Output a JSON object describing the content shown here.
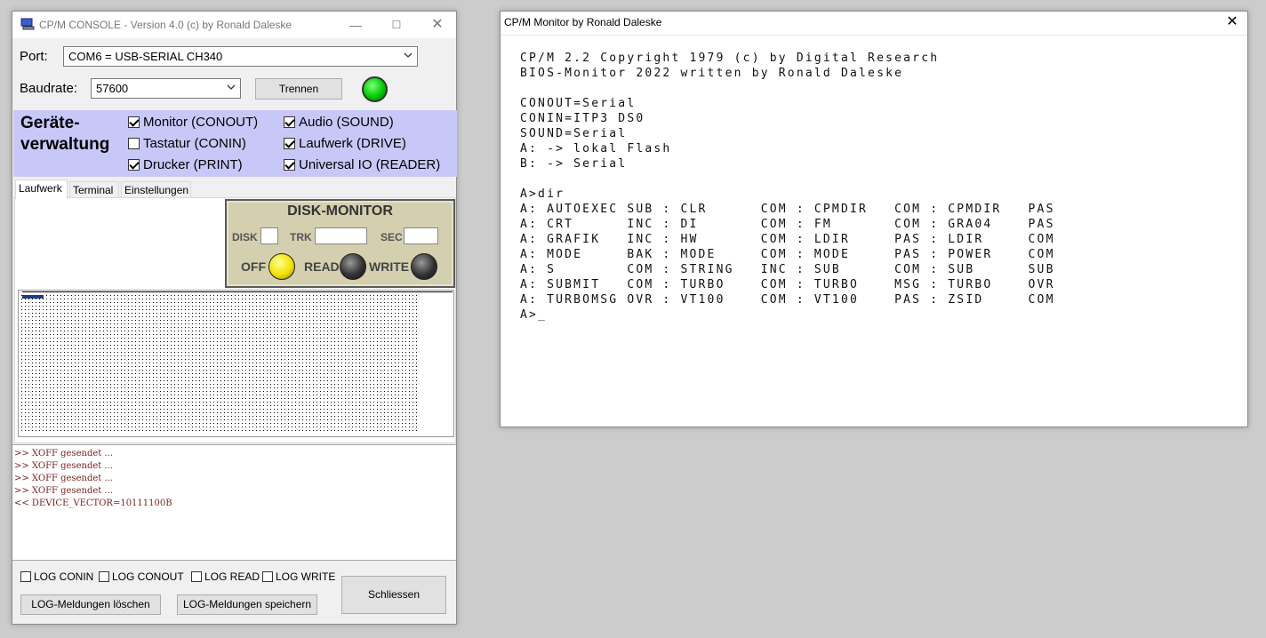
{
  "console": {
    "title": "CP/M CONSOLE - Version 4.0 (c) by Ronald Daleske",
    "port_label": "Port:",
    "port_value": "COM6 = USB-SERIAL CH340",
    "baudrate_label": "Baudrate:",
    "baudrate_value": "57600",
    "disconnect_button": "Trennen",
    "status_led_color": "#00cc00",
    "devices": {
      "title_line1": "Geräte-",
      "title_line2": "verwaltung",
      "items": [
        {
          "label": "Monitor (CONOUT)",
          "checked": true
        },
        {
          "label": "Tastatur (CONIN)",
          "checked": false
        },
        {
          "label": "Drucker (PRINT)",
          "checked": true
        },
        {
          "label": "Audio (SOUND)",
          "checked": true
        },
        {
          "label": "Laufwerk (DRIVE)",
          "checked": true
        },
        {
          "label": "Universal IO (READER)",
          "checked": true
        }
      ]
    },
    "tabs": [
      "Laufwerk",
      "Terminal",
      "Einstellungen"
    ],
    "disk_monitor": {
      "title": "DISK-MONITOR",
      "disk_label": "DISK",
      "trk_label": "TRK",
      "sec_label": "SEC",
      "off_label": "OFF",
      "read_label": "READ",
      "write_label": "WRITE",
      "off_color": "#f2e200",
      "read_color": "#333333",
      "write_color": "#333333"
    },
    "log_lines": [
      ">> XOFF gesendet ...",
      ">> XOFF gesendet ...",
      ">> XOFF gesendet ...",
      ">> XOFF gesendet ...",
      "<< DEVICE_VECTOR=10111100B"
    ],
    "log_options": [
      "LOG CONIN",
      "LOG CONOUT",
      "LOG READ",
      "LOG WRITE"
    ],
    "clear_log_button": "LOG-Meldungen löschen",
    "save_log_button": "LOG-Meldungen speichern",
    "close_button": "Schliessen"
  },
  "monitor": {
    "title": "CP/M Monitor by Ronald Daleske",
    "lines": [
      "CP/M 2.2 Copyright 1979 (c) by Digital Research",
      "BIOS-Monitor 2022 written by Ronald Daleske",
      "",
      "CONOUT=Serial",
      "CONIN=ITP3 DS0",
      "SOUND=Serial",
      "A: -> lokal Flash",
      "B: -> Serial",
      "",
      "A>dir",
      "A: AUTOEXEC SUB : CLR      COM : CPMDIR   COM : CPMDIR   PAS",
      "A: CRT      INC : DI       COM : FM       COM : GRA04    PAS",
      "A: GRAFIK   INC : HW       COM : LDIR     PAS : LDIR     COM",
      "A: MODE     BAK : MODE     COM : MODE     PAS : POWER    COM",
      "A: S        COM : STRING   INC : SUB      COM : SUB      SUB",
      "A: SUBMIT   COM : TURBO    COM : TURBO    MSG : TURBO    OVR",
      "A: TURBOMSG OVR : VT100    COM : VT100    PAS : ZSID     COM",
      "A>_"
    ]
  }
}
